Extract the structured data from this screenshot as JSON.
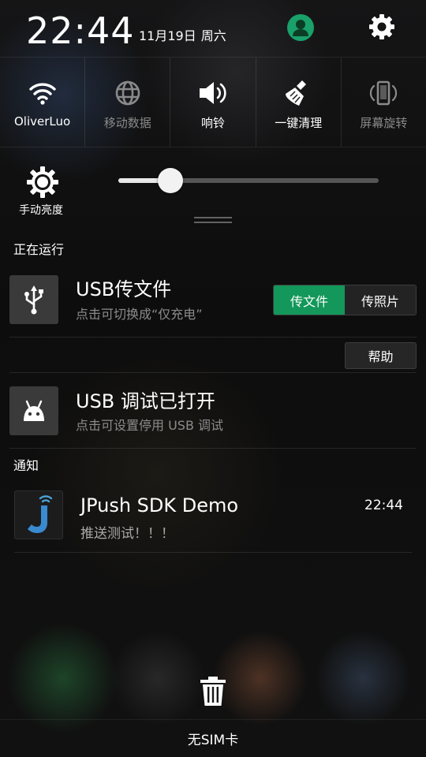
{
  "status": {
    "time": "22:44",
    "date": "11月19日",
    "weekday": "周六",
    "avatar_icon": "user-avatar-icon",
    "settings_icon": "gear-icon"
  },
  "toggles": [
    {
      "label": "OliverLuo",
      "icon": "wifi-icon",
      "active": true
    },
    {
      "label": "移动数据",
      "icon": "globe-icon",
      "active": false
    },
    {
      "label": "响铃",
      "icon": "speaker-icon",
      "active": true
    },
    {
      "label": "一键清理",
      "icon": "broom-icon",
      "active": true
    },
    {
      "label": "屏幕旋转",
      "icon": "rotate-phone-icon",
      "active": false
    }
  ],
  "brightness": {
    "label": "手动亮度",
    "level": 0.2
  },
  "running": {
    "title": "正在运行",
    "usb": {
      "title": "USB传文件",
      "subtitle": "点击可切换成“仅充电”",
      "option_active": "传文件",
      "option_inactive": "传照片",
      "help": "帮助"
    },
    "debug": {
      "title": "USB 调试已打开",
      "subtitle": "点击可设置停用 USB 调试"
    }
  },
  "notifications": {
    "title": "通知",
    "items": [
      {
        "title": "JPush SDK Demo",
        "time": "22:44",
        "body": "推送测试！！！"
      }
    ]
  },
  "footer": {
    "carrier": "无SIM卡"
  },
  "colors": {
    "accent": "#13975a",
    "avatar": "#1aa06a"
  }
}
